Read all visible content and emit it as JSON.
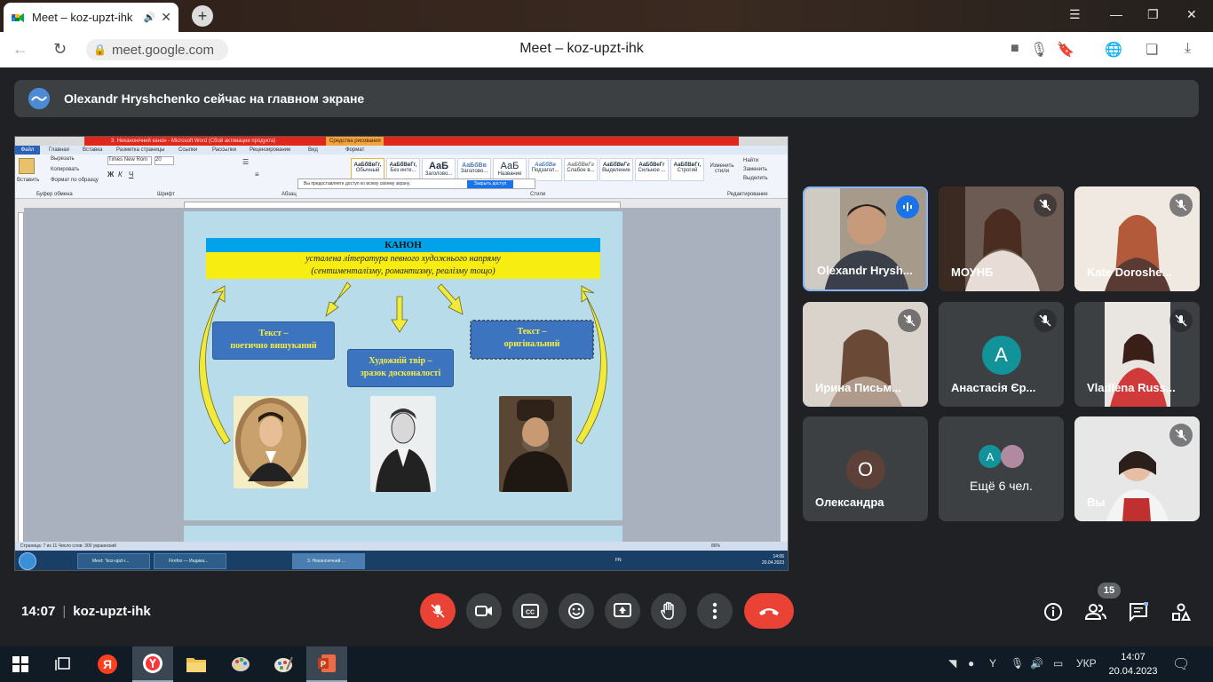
{
  "browser": {
    "tab_title": "Meet – koz-upzt-ihk",
    "new_tab_label": "+",
    "url": "meet.google.com",
    "page_title": "Meet – koz-upzt-ihk"
  },
  "banner": {
    "text": "Olexandr Hryshchenko сейчас на главном экране"
  },
  "shared_screen": {
    "word_title": "3. Неканонічний канон - Microsoft Word (Сбой активации продукта)",
    "drawing_tools": "Средства рисования",
    "ribbon_tabs": [
      "Файл",
      "Главная",
      "Вставка",
      "Разметка страницы",
      "Ссылки",
      "Рассылки",
      "Рецензирование",
      "Вид",
      "Формат"
    ],
    "clipboard": [
      "Вырезать",
      "Копировать",
      "Формат по образцу"
    ],
    "paste_label": "Вставить",
    "font_name": "Times New Rom",
    "font_size": "20",
    "styles": [
      {
        "sample": "АаБбВвГг,",
        "name": "Обычный"
      },
      {
        "sample": "АаБбВвГг,",
        "name": "Без инте..."
      },
      {
        "sample": "АаБ",
        "name": "Заголово..."
      },
      {
        "sample": "АаБбВв",
        "name": "Заголово..."
      },
      {
        "sample": "АаБ",
        "name": "Название"
      },
      {
        "sample": "АаБбВв",
        "name": "Подзагол..."
      },
      {
        "sample": "АаБбВеГг",
        "name": "Слабое в..."
      },
      {
        "sample": "АаБбВеГг",
        "name": "Выделение"
      },
      {
        "sample": "АаБбВеГг",
        "name": "Сильное ..."
      },
      {
        "sample": "АаБбВвГг,",
        "name": "Строгий"
      }
    ],
    "edit_items": [
      "Найти",
      "Заменить",
      "Выделить"
    ],
    "change_styles": "Изменить стили",
    "share_notice": "Вы предоставляете доступ ко всему своему экрану.",
    "stop_sharing": "Закрыть доступ",
    "group_labels": [
      "Буфер обмена",
      "Шрифт",
      "Абзац",
      "Стили",
      "Редактирование"
    ],
    "slide": {
      "header": "КАНОН",
      "subtitle_line1": "усталена література певного художнього напряму",
      "subtitle_line2": "(сентименталізму, романтизму, реалізму тощо)",
      "box_left_line1": "Текст –",
      "box_left_line2": "поетично вишуканий",
      "box_center_line1": "Художній твір –",
      "box_center_line2": "зразок досконалості",
      "box_right_line1": "Текст –",
      "box_right_line2": "оригінальний"
    },
    "status": "Страница: 7 из 11   Число слов: 300   украинский",
    "zoom": "86%",
    "taskbar_items": [
      "Meet: \"koz-upzt-i...",
      "Firefox — Индика...",
      "3. Неканонічний ..."
    ],
    "lang": "FN",
    "time": "14:06",
    "date": "20.04.2023"
  },
  "participants": [
    {
      "name": "Olexandr Hrysh...",
      "muted": false,
      "speaking": true,
      "video": true
    },
    {
      "name": "МОУНБ",
      "muted": true,
      "video": true
    },
    {
      "name": "Kate Doroshe...",
      "muted": true,
      "video": true
    },
    {
      "name": "Ирина Письм...",
      "muted": true,
      "video": true
    },
    {
      "name": "Анастасія Єр...",
      "muted": true,
      "video": false,
      "letter": "А",
      "color": "#12939a"
    },
    {
      "name": "Vladlena Russ...",
      "muted": true,
      "video": true
    },
    {
      "name": "Олександра",
      "muted": false,
      "video": false,
      "letter": "О",
      "color": "#5d4037"
    },
    {
      "name": "Ещё 6 чел.",
      "muted": false,
      "video": false,
      "letter": "А",
      "color": "#12939a"
    },
    {
      "name": "Вы",
      "muted": true,
      "video": true
    }
  ],
  "controls": {
    "time": "14:07",
    "meeting_code": "koz-upzt-ihk",
    "participant_count": "15"
  },
  "os_taskbar": {
    "lang": "УКР",
    "time": "14:07",
    "date": "20.04.2023"
  },
  "colors": {
    "meet_bg": "#202124",
    "tile_bg": "#3c4043",
    "danger": "#ea4335",
    "speaking_border": "#8ab4f8"
  }
}
